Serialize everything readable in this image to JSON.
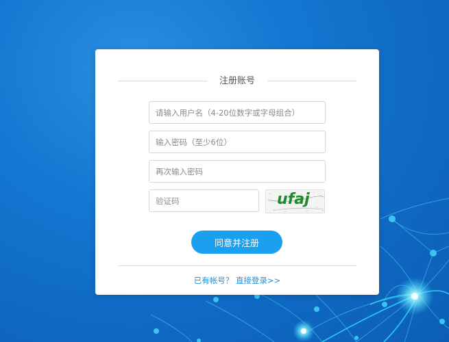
{
  "register": {
    "title": "注册账号",
    "username_placeholder": "请输入用户名（4-20位数字或字母组合）",
    "password_placeholder": "输入密码（至少6位）",
    "confirm_placeholder": "再次输入密码",
    "code_placeholder": "验证码",
    "captcha_text": "ufaj",
    "submit_label": "同意并注册",
    "have_account_text": "已有帐号？",
    "login_link_label": "直接登录>>"
  },
  "colors": {
    "background": "#1478d2",
    "button": "#1aa0ef",
    "link": "#1a8fe0",
    "captcha_text": "#1f8a2a"
  }
}
